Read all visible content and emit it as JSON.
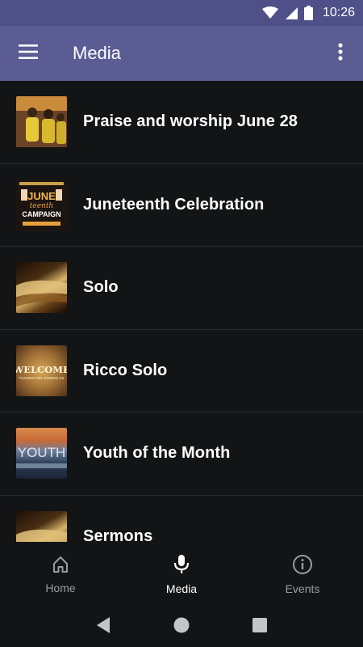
{
  "status_bar": {
    "time": "10:26"
  },
  "app_bar": {
    "title": "Media"
  },
  "media_items": [
    {
      "title": "Praise and worship June 28"
    },
    {
      "title": "Juneteenth Celebration"
    },
    {
      "title": "Solo"
    },
    {
      "title": "Ricco Solo"
    },
    {
      "title": "Youth of the Month"
    },
    {
      "title": "Sermons"
    }
  ],
  "bottom_nav": {
    "items": [
      {
        "label": "Home",
        "icon": "home-icon"
      },
      {
        "label": "Media",
        "icon": "microphone-icon",
        "active": true
      },
      {
        "label": "Events",
        "icon": "info-icon"
      }
    ]
  },
  "thumbnails": {
    "juneteenth": {
      "line1": "JUNE",
      "line2": "teenth",
      "line3": "CAMPAIGN"
    },
    "welcome": {
      "line1": "WELCOME",
      "line2": "THANKS FOR JOINING US"
    },
    "youth": {
      "line1": "YOUTH"
    }
  }
}
